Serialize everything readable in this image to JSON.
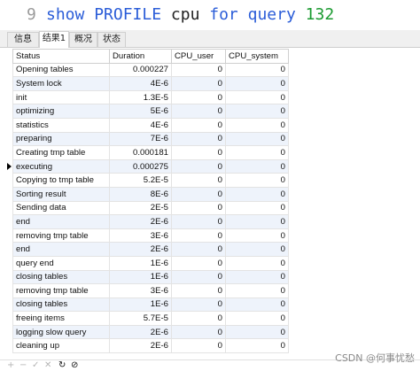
{
  "editor": {
    "line_number": "9",
    "code_tokens": [
      {
        "text": "show",
        "kind": "kw"
      },
      {
        "text": " ",
        "kind": "txt"
      },
      {
        "text": "PROFILE",
        "kind": "kw"
      },
      {
        "text": " cpu ",
        "kind": "txt"
      },
      {
        "text": "for",
        "kind": "kw"
      },
      {
        "text": " ",
        "kind": "txt"
      },
      {
        "text": "query",
        "kind": "kw"
      },
      {
        "text": " ",
        "kind": "txt"
      },
      {
        "text": "132",
        "kind": "num"
      }
    ]
  },
  "tabs": [
    {
      "label": "信息",
      "active": false
    },
    {
      "label": "结果1",
      "active": true
    },
    {
      "label": "概况",
      "active": false
    },
    {
      "label": "状态",
      "active": false
    }
  ],
  "table": {
    "columns": [
      "Status",
      "Duration",
      "CPU_user",
      "CPU_system"
    ],
    "current_row": 7,
    "rows": [
      [
        "Opening tables",
        "0.000227",
        "0",
        "0"
      ],
      [
        "System lock",
        "4E-6",
        "0",
        "0"
      ],
      [
        "init",
        "1.3E-5",
        "0",
        "0"
      ],
      [
        "optimizing",
        "5E-6",
        "0",
        "0"
      ],
      [
        "statistics",
        "4E-6",
        "0",
        "0"
      ],
      [
        "preparing",
        "7E-6",
        "0",
        "0"
      ],
      [
        "Creating tmp table",
        "0.000181",
        "0",
        "0"
      ],
      [
        "executing",
        "0.000275",
        "0",
        "0"
      ],
      [
        "Copying to tmp table",
        "5.2E-5",
        "0",
        "0"
      ],
      [
        "Sorting result",
        "8E-6",
        "0",
        "0"
      ],
      [
        "Sending data",
        "2E-5",
        "0",
        "0"
      ],
      [
        "end",
        "2E-6",
        "0",
        "0"
      ],
      [
        "removing tmp table",
        "3E-6",
        "0",
        "0"
      ],
      [
        "end",
        "2E-6",
        "0",
        "0"
      ],
      [
        "query end",
        "1E-6",
        "0",
        "0"
      ],
      [
        "closing tables",
        "1E-6",
        "0",
        "0"
      ],
      [
        "removing tmp table",
        "3E-6",
        "0",
        "0"
      ],
      [
        "closing tables",
        "1E-6",
        "0",
        "0"
      ],
      [
        "freeing items",
        "5.7E-5",
        "0",
        "0"
      ],
      [
        "logging slow query",
        "2E-6",
        "0",
        "0"
      ],
      [
        "cleaning up",
        "2E-6",
        "0",
        "0"
      ]
    ]
  },
  "statusbar": {
    "buttons": [
      {
        "icon": "plus-icon",
        "glyph": "+",
        "enabled": false
      },
      {
        "icon": "minus-icon",
        "glyph": "−",
        "enabled": false
      },
      {
        "icon": "check-icon",
        "glyph": "✓",
        "enabled": false
      },
      {
        "icon": "cross-icon",
        "glyph": "✕",
        "enabled": false
      },
      {
        "icon": "refresh-icon",
        "glyph": "↻",
        "enabled": true
      },
      {
        "icon": "stop-icon",
        "glyph": "⊘",
        "enabled": true
      }
    ]
  },
  "watermark": "CSDN @何事忧愁"
}
